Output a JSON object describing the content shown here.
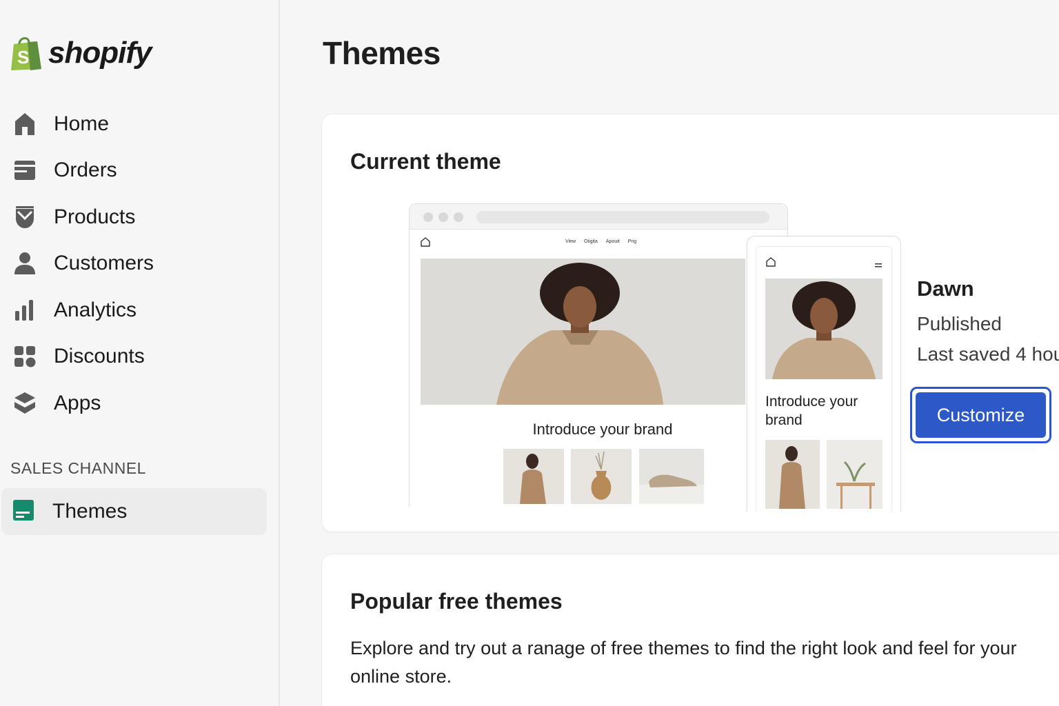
{
  "brand": {
    "name": "shopify",
    "color": "#95bf47"
  },
  "sidebar": {
    "items": [
      {
        "label": "Home",
        "icon": "home-icon"
      },
      {
        "label": "Orders",
        "icon": "orders-icon"
      },
      {
        "label": "Products",
        "icon": "products-icon"
      },
      {
        "label": "Customers",
        "icon": "customers-icon"
      },
      {
        "label": "Analytics",
        "icon": "analytics-icon"
      },
      {
        "label": "Discounts",
        "icon": "discounts-icon"
      },
      {
        "label": "Apps",
        "icon": "apps-icon"
      }
    ],
    "section_label": "SALES CHANNEL",
    "active_item": {
      "label": "Themes",
      "icon": "themes-icon",
      "color": "#168a6a"
    }
  },
  "page": {
    "title": "Themes"
  },
  "current_theme": {
    "heading": "Current theme",
    "preview": {
      "desktop_links": [
        "View",
        "Oiigita",
        "Apouit",
        "Png"
      ],
      "desktop_hero_text": "Introduce your brand",
      "mobile_hero_text": "Introduce your brand"
    },
    "name": "Dawn",
    "status": "Published",
    "last_saved": "Last saved 4 hou",
    "customize_label": "Customize",
    "accent": "#2d59c8"
  },
  "popular": {
    "heading": "Popular free themes",
    "description": "Explore and try out a ranage of free themes to find the right look and feel for your online store."
  }
}
